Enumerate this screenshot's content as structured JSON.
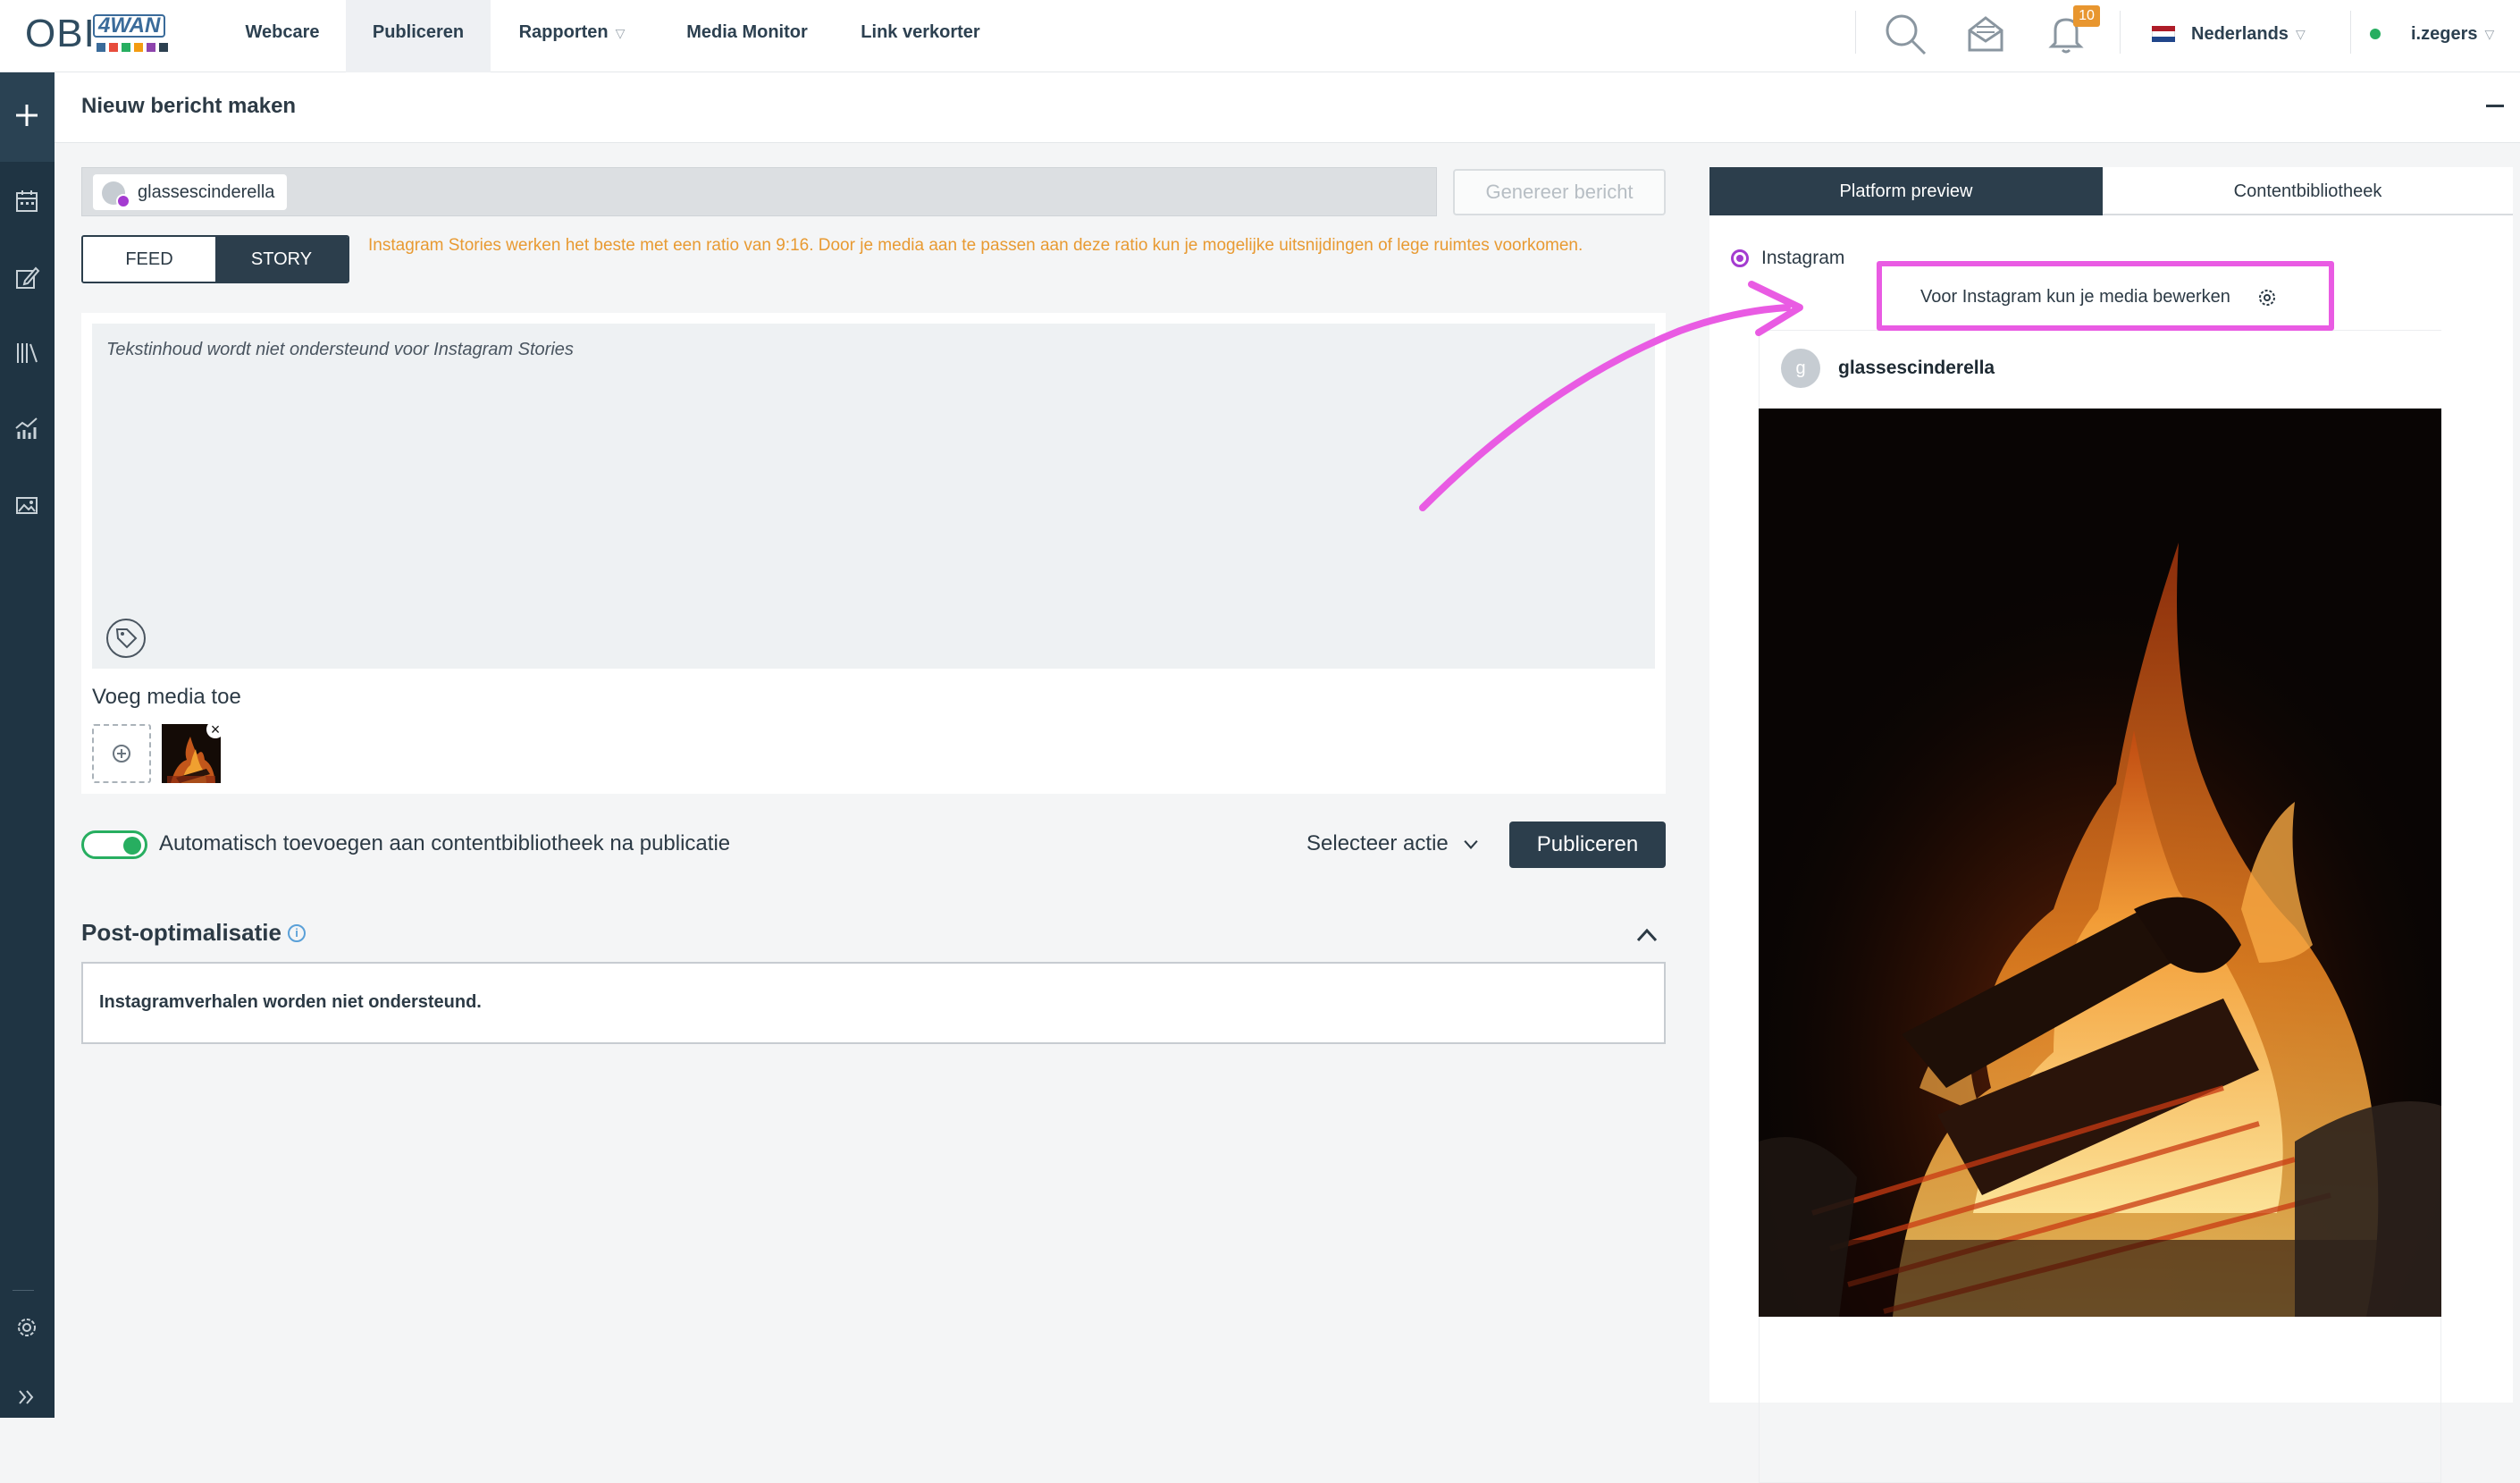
{
  "brand": {
    "logo_text": "OBI",
    "logo_sub": "4WAN",
    "logo_colors": [
      "#3a6b9a",
      "#e74c3c",
      "#27ae60",
      "#f39c12",
      "#8e44ad",
      "#2c4050"
    ]
  },
  "nav": {
    "items": [
      {
        "label": "Webcare"
      },
      {
        "label": "Publiceren",
        "active": true
      },
      {
        "label": "Rapporten",
        "has_caret": true
      },
      {
        "label": "Media Monitor"
      },
      {
        "label": "Link verkorter"
      }
    ],
    "caret_icon": "chevron-down-icon"
  },
  "topbar": {
    "icons": [
      "search-icon",
      "inbox-icon",
      "bell-icon"
    ],
    "notification_count": "10",
    "language": "Nederlands",
    "user": "i.zegers",
    "online_color": "#27ae60"
  },
  "sidebar": {
    "icons": [
      "plus-icon",
      "calendar-icon",
      "edit-icon",
      "library-icon",
      "analytics-icon",
      "image-icon",
      "settings-icon",
      "expand-icon"
    ]
  },
  "page": {
    "title": "Nieuw bericht maken"
  },
  "composer": {
    "account": {
      "name": "glassescinderella",
      "platform": "instagram"
    },
    "generate_label": "Genereer bericht",
    "format_tabs": [
      {
        "label": "FEED",
        "active": false
      },
      {
        "label": "STORY",
        "active": true
      }
    ],
    "story_warning": "Instagram Stories werken het beste met een ratio van 9:16. Door je media aan te passen aan deze ratio kun je mogelijke uitsnijdingen of lege ruimtes voorkomen.",
    "editor_hint": "Tekstinhoud wordt niet ondersteund voor Instagram Stories",
    "media_label": "Voeg media toe",
    "auto_add_label": "Automatisch toevoegen aan contentbibliotheek na publicatie",
    "auto_add_enabled": true,
    "action_label": "Selecteer actie",
    "publish_label": "Publiceren"
  },
  "optimization": {
    "title": "Post-optimalisatie",
    "message": "Instagramverhalen worden niet ondersteund."
  },
  "preview": {
    "tabs": [
      {
        "label": "Platform preview",
        "active": true
      },
      {
        "label": "Contentbibliotheek",
        "active": false
      }
    ],
    "platform_label": "Instagram",
    "edit_note": "Voor Instagram kun je media bewerken",
    "username": "glassescinderella",
    "avatar_letter": "g"
  },
  "colors": {
    "primary_dark": "#2c3e4c",
    "warning": "#e89a32",
    "annotation": "#e95be3",
    "instagram": "#a43bd0"
  }
}
